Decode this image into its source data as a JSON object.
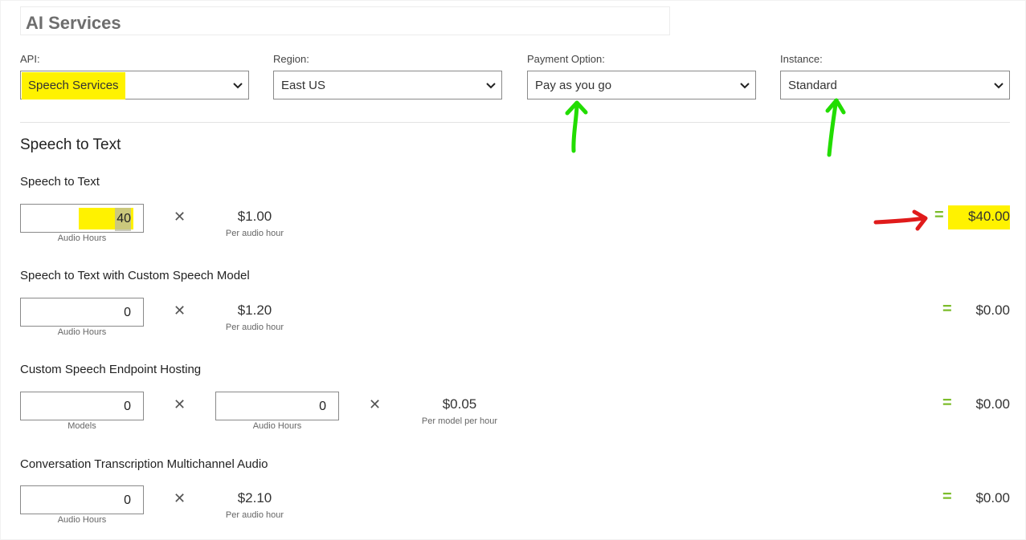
{
  "header": {
    "title": "AI Services"
  },
  "filters": {
    "api": {
      "label": "API:",
      "value": "Speech Services"
    },
    "region": {
      "label": "Region:",
      "value": "East US"
    },
    "payment": {
      "label": "Payment Option:",
      "value": "Pay as you go"
    },
    "instance": {
      "label": "Instance:",
      "value": "Standard"
    }
  },
  "section": {
    "title": "Speech to Text"
  },
  "rows": [
    {
      "title": "Speech to Text",
      "qty": "40",
      "qty_unit": "Audio Hours",
      "price": "$1.00",
      "price_unit": "Per audio hour",
      "total": "$40.00"
    },
    {
      "title": "Speech to Text with Custom Speech Model",
      "qty": "0",
      "qty_unit": "Audio Hours",
      "price": "$1.20",
      "price_unit": "Per audio hour",
      "total": "$0.00"
    },
    {
      "title": "Custom Speech Endpoint Hosting",
      "qty": "0",
      "qty_unit": "Models",
      "qty2": "0",
      "qty2_unit": "Audio Hours",
      "price": "$0.05",
      "price_unit": "Per model per hour",
      "total": "$0.00"
    },
    {
      "title": "Conversation Transcription Multichannel Audio",
      "qty": "0",
      "qty_unit": "Audio Hours",
      "price": "$2.10",
      "price_unit": "Per audio hour",
      "total": "$0.00"
    }
  ],
  "symbols": {
    "times": "✕",
    "equals": "="
  },
  "colors": {
    "equals_green": "#7cbd2b",
    "highlight_yellow": "#fff200",
    "arrow_green": "#22dd00",
    "arrow_red": "#e01b1b"
  }
}
